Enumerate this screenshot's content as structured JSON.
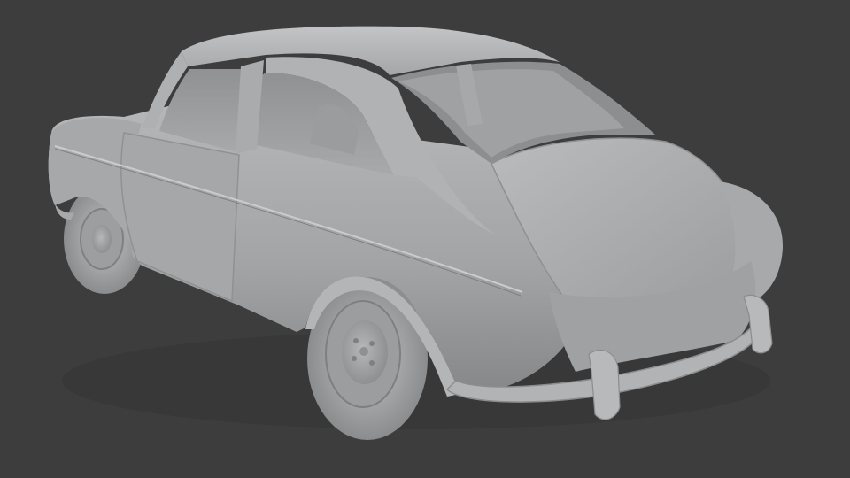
{
  "scene": {
    "background_color": "#3d3d3d",
    "model_base_color": "#a9abad",
    "model_shadow_color": "#6f7173",
    "model_highlight_color": "#c4c6c8",
    "subject": "car-model-clay-render"
  }
}
